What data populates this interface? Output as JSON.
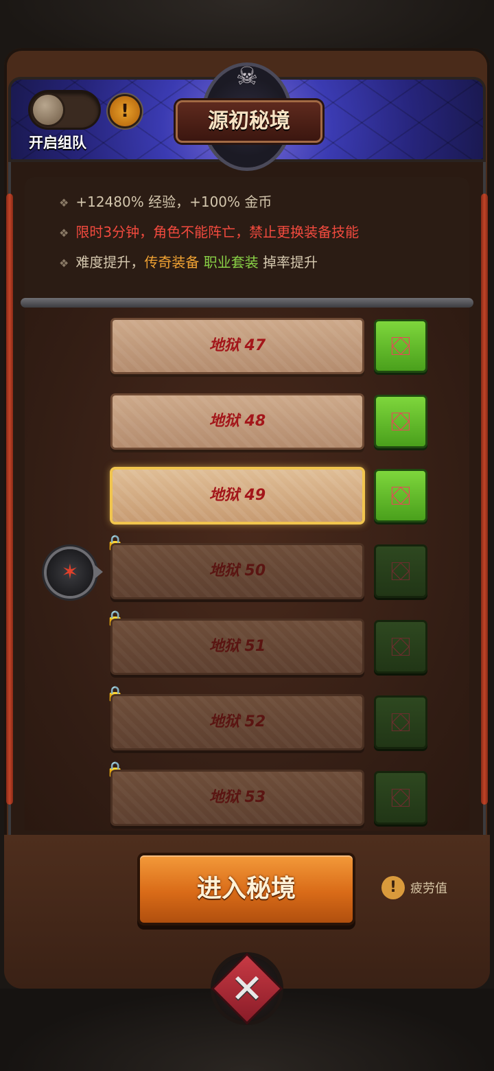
{
  "header": {
    "title": "源初秘境",
    "team_toggle_label": "开启组队",
    "team_toggle_on": false
  },
  "info": {
    "line1": "+12480% 经验，+100% 金币",
    "line2": "限时3分钟，角色不能阵亡，禁止更换装备技能",
    "line3_prefix": "难度提升，",
    "line3_orange": "传奇装备",
    "line3_green": "职业套装",
    "line3_suffix": "掉率提升"
  },
  "levels": [
    {
      "label": "地狱 47",
      "locked": false,
      "selected": false
    },
    {
      "label": "地狱 48",
      "locked": false,
      "selected": false
    },
    {
      "label": "地狱 49",
      "locked": false,
      "selected": true
    },
    {
      "label": "地狱 50",
      "locked": true,
      "selected": false
    },
    {
      "label": "地狱 51",
      "locked": true,
      "selected": false
    },
    {
      "label": "地狱 52",
      "locked": true,
      "selected": false
    },
    {
      "label": "地狱 53",
      "locked": true,
      "selected": false
    }
  ],
  "enter_button": "进入秘境",
  "fatigue_label": "疲劳值",
  "icons": {
    "info": "!",
    "skull": "☠",
    "chest": "⛋",
    "lock": "🔒",
    "avatar": "✶",
    "close": "✕"
  },
  "colors": {
    "accent_orange": "#f0a233",
    "accent_green": "#89d146",
    "warning_red": "#f24a3e"
  }
}
